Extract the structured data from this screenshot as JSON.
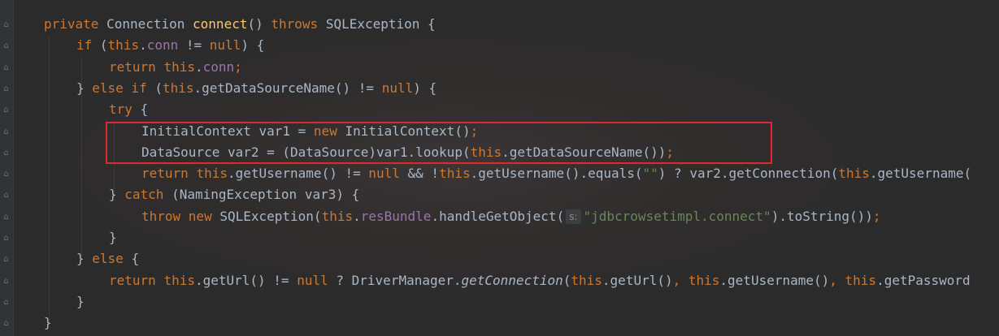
{
  "editor": {
    "lines": [
      {
        "indent": 0,
        "tokens": [
          {
            "t": "private ",
            "c": "kw"
          },
          {
            "t": "Connection ",
            "c": "plain"
          },
          {
            "t": "connect",
            "c": "fn"
          },
          {
            "t": "() ",
            "c": "plain"
          },
          {
            "t": "throws ",
            "c": "kw"
          },
          {
            "t": "SQLException {",
            "c": "plain"
          }
        ]
      },
      {
        "indent": 1,
        "tokens": [
          {
            "t": "if ",
            "c": "kw"
          },
          {
            "t": "(",
            "c": "plain"
          },
          {
            "t": "this",
            "c": "kw"
          },
          {
            "t": ".",
            "c": "plain"
          },
          {
            "t": "conn",
            "c": "fld"
          },
          {
            "t": " != ",
            "c": "plain"
          },
          {
            "t": "null",
            "c": "kw"
          },
          {
            "t": ") {",
            "c": "plain"
          }
        ]
      },
      {
        "indent": 2,
        "tokens": [
          {
            "t": "return ",
            "c": "kw"
          },
          {
            "t": "this",
            "c": "kw"
          },
          {
            "t": ".",
            "c": "plain"
          },
          {
            "t": "conn",
            "c": "fld"
          },
          {
            "t": ";",
            "c": "kw"
          }
        ]
      },
      {
        "indent": 1,
        "tokens": [
          {
            "t": "} ",
            "c": "plain"
          },
          {
            "t": "else if ",
            "c": "kw"
          },
          {
            "t": "(",
            "c": "plain"
          },
          {
            "t": "this",
            "c": "kw"
          },
          {
            "t": ".getDataSourceName() != ",
            "c": "plain"
          },
          {
            "t": "null",
            "c": "kw"
          },
          {
            "t": ") {",
            "c": "plain"
          }
        ]
      },
      {
        "indent": 2,
        "tokens": [
          {
            "t": "try ",
            "c": "kw"
          },
          {
            "t": "{",
            "c": "plain"
          }
        ]
      },
      {
        "indent": 3,
        "tokens": [
          {
            "t": "InitialContext var1 = ",
            "c": "plain"
          },
          {
            "t": "new ",
            "c": "kw"
          },
          {
            "t": "InitialContext()",
            "c": "plain"
          },
          {
            "t": ";",
            "c": "kw"
          }
        ]
      },
      {
        "indent": 3,
        "tokens": [
          {
            "t": "DataSource var2 = (DataSource)var1.lookup(",
            "c": "plain"
          },
          {
            "t": "this",
            "c": "kw"
          },
          {
            "t": ".getDataSourceName())",
            "c": "plain"
          },
          {
            "t": ";",
            "c": "kw"
          }
        ]
      },
      {
        "indent": 3,
        "tokens": [
          {
            "t": "return ",
            "c": "kw"
          },
          {
            "t": "this",
            "c": "kw"
          },
          {
            "t": ".getUsername() != ",
            "c": "plain"
          },
          {
            "t": "null ",
            "c": "kw"
          },
          {
            "t": "&& !",
            "c": "plain"
          },
          {
            "t": "this",
            "c": "kw"
          },
          {
            "t": ".getUsername().equals(",
            "c": "plain"
          },
          {
            "t": "\"\"",
            "c": "str"
          },
          {
            "t": ") ? var2.getConnection(",
            "c": "plain"
          },
          {
            "t": "this",
            "c": "kw"
          },
          {
            "t": ".getUsername(",
            "c": "plain"
          }
        ]
      },
      {
        "indent": 2,
        "tokens": [
          {
            "t": "} ",
            "c": "plain"
          },
          {
            "t": "catch ",
            "c": "kw"
          },
          {
            "t": "(NamingException var3) {",
            "c": "plain"
          }
        ]
      },
      {
        "indent": 3,
        "tokens": [
          {
            "t": "throw new ",
            "c": "kw"
          },
          {
            "t": "SQLException(",
            "c": "plain"
          },
          {
            "t": "this",
            "c": "kw"
          },
          {
            "t": ".",
            "c": "plain"
          },
          {
            "t": "resBundle",
            "c": "fld"
          },
          {
            "t": ".handleGetObject(",
            "c": "plain"
          },
          {
            "t": "s:",
            "c": "hint"
          },
          {
            "t": "\"jdbcrowsetimpl.connect\"",
            "c": "str"
          },
          {
            "t": ").toString())",
            "c": "plain"
          },
          {
            "t": ";",
            "c": "kw"
          }
        ]
      },
      {
        "indent": 2,
        "tokens": [
          {
            "t": "}",
            "c": "plain"
          }
        ]
      },
      {
        "indent": 1,
        "tokens": [
          {
            "t": "} ",
            "c": "plain"
          },
          {
            "t": "else ",
            "c": "kw"
          },
          {
            "t": "{",
            "c": "plain"
          }
        ]
      },
      {
        "indent": 2,
        "tokens": [
          {
            "t": "return ",
            "c": "kw"
          },
          {
            "t": "this",
            "c": "kw"
          },
          {
            "t": ".getUrl() != ",
            "c": "plain"
          },
          {
            "t": "null ",
            "c": "kw"
          },
          {
            "t": "? DriverManager.",
            "c": "plain"
          },
          {
            "t": "getConnection",
            "c": "it"
          },
          {
            "t": "(",
            "c": "plain"
          },
          {
            "t": "this",
            "c": "kw"
          },
          {
            "t": ".getUrl()",
            "c": "plain"
          },
          {
            "t": ", ",
            "c": "kw"
          },
          {
            "t": "this",
            "c": "kw"
          },
          {
            "t": ".getUsername()",
            "c": "plain"
          },
          {
            "t": ", ",
            "c": "kw"
          },
          {
            "t": "this",
            "c": "kw"
          },
          {
            "t": ".getPassword",
            "c": "plain"
          }
        ]
      },
      {
        "indent": 1,
        "tokens": [
          {
            "t": "}",
            "c": "plain"
          }
        ]
      },
      {
        "indent": 0,
        "tokens": [
          {
            "t": "}",
            "c": "plain"
          }
        ]
      }
    ]
  },
  "colors": {
    "background": "#2b2b2b",
    "keyword": "#cc7832",
    "function": "#ffc66d",
    "field": "#9876aa",
    "string": "#6a8759",
    "text": "#a9b7c6",
    "highlight_box": "#e0282e"
  },
  "gutter_icons": [
    "fold-icon",
    "fold-icon",
    "fold-icon",
    "fold-icon",
    "fold-icon",
    "fold-icon",
    "fold-icon",
    "fold-icon",
    "fold-icon",
    "fold-icon",
    "fold-icon",
    "fold-icon",
    "fold-icon",
    "fold-icon",
    "fold-icon"
  ]
}
